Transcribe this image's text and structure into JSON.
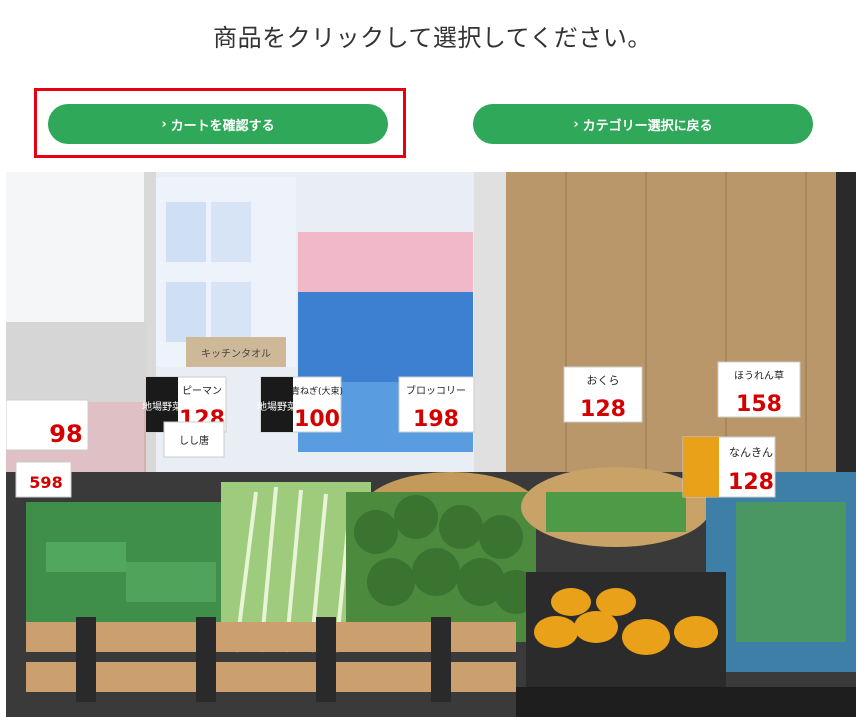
{
  "page": {
    "title": "商品をクリックして選択してください。"
  },
  "buttons": {
    "cart_label": "カートを確認する",
    "back_label": "カテゴリー選択に戻る",
    "chevron": "›"
  },
  "colors": {
    "button_green": "#2fa85a",
    "highlight_red": "#e60012",
    "title_text": "#333333"
  },
  "photo": {
    "price_tags": [
      {
        "label": "ピーマン",
        "price": "128",
        "sticker": "地場野菜"
      },
      {
        "label": "しし唐",
        "price": "",
        "sticker": "地場野菜"
      },
      {
        "label": "青ねぎ(大束)",
        "price": "100",
        "sticker": "地場野菜"
      },
      {
        "label": "ブロッコリー",
        "price": "198",
        "sticker": ""
      },
      {
        "label": "おくら",
        "price": "128",
        "sticker": ""
      },
      {
        "label": "ほうれん草",
        "price": "158",
        "sticker": ""
      },
      {
        "label": "なんきん",
        "price": "128",
        "sticker": ""
      },
      {
        "label": "",
        "price": "98",
        "sticker": ""
      },
      {
        "label": "",
        "price": "598",
        "sticker": ""
      }
    ],
    "background_text": "キッチンタオル"
  }
}
